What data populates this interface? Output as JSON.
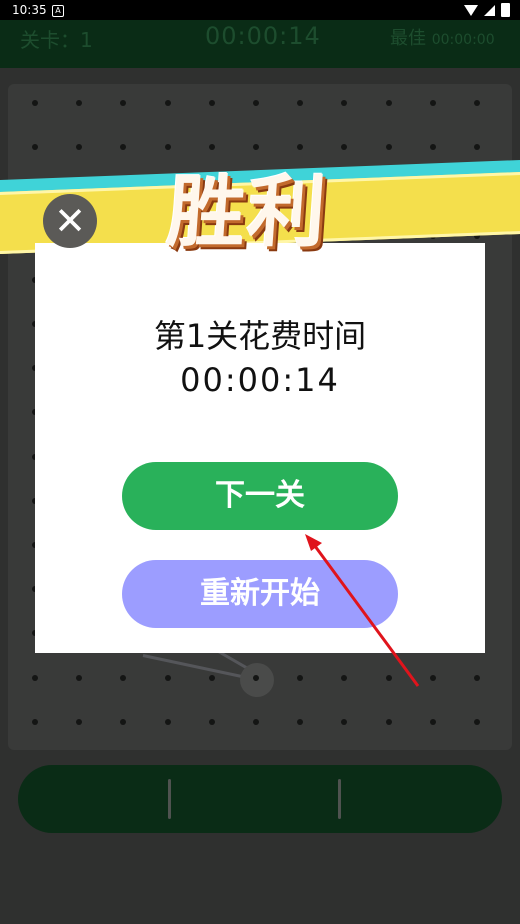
{
  "status_bar": {
    "time": "10:35",
    "notification_icon": "A"
  },
  "game_header": {
    "level": "关卡：1",
    "timer": "00:00:14",
    "best_label": "最佳",
    "best_time": "00:00:00"
  },
  "victory": {
    "title": "胜利"
  },
  "dialog": {
    "title": "第1关花费时间",
    "time": "00:00:14",
    "next_label": "下一关",
    "restart_label": "重新开始"
  },
  "colors": {
    "accent_green": "#29b15a",
    "restart_purple": "#9c9dff",
    "banner_yellow": "#f4df4c",
    "banner_cyan": "#3fd3d8",
    "annotation_red": "#e0141c"
  },
  "icons": {
    "close": "close-icon",
    "annotation": "red-arrow-annotation"
  }
}
